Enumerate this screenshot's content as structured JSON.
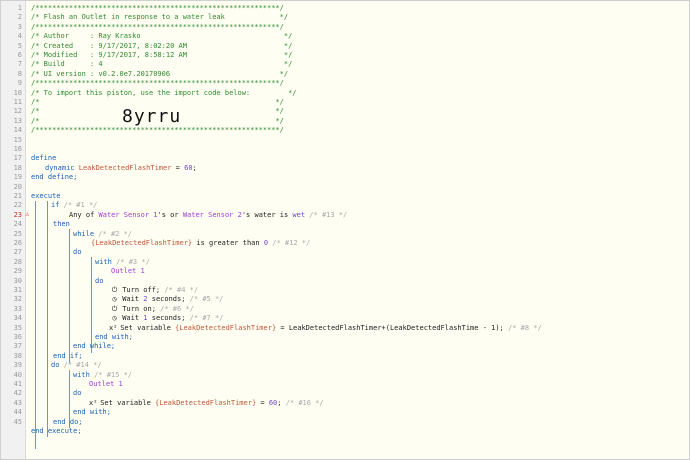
{
  "line_numbers": [
    "1",
    "2",
    "3",
    "4",
    "5",
    "6",
    "7",
    "8",
    "9",
    "10",
    "11",
    "12",
    "13",
    "14",
    "15",
    "16",
    "17",
    "18",
    "19",
    "20",
    "21",
    "22",
    "23",
    "24",
    "25",
    "26",
    "27",
    "28",
    "29",
    "30",
    "31",
    "32",
    "33",
    "34",
    "35",
    "36",
    "37",
    "38",
    "39",
    "40",
    "41",
    "42",
    "43",
    "44",
    "45"
  ],
  "header": {
    "border": "/**********************************************************/",
    "title": "/* Flash an Outlet in response to a water leak             */",
    "author": "/* Author     : Ray Krasko                                  */",
    "created": "/* Created    : 9/17/2017, 8:02:20 AM                       */",
    "modified": "/* Modified   : 9/17/2017, 8:58:12 AM                       */",
    "build": "/* Build      : 4                                           */",
    "ui_version": "/* UI version : v0.2.0e7.20170906                          */",
    "import_text": "/* To import this piston, use the import code below:         */",
    "blank_line": "/*                                                        */",
    "import_code": "8yrru"
  },
  "code": {
    "define": "define",
    "dynamic": "dynamic",
    "var_name": "LeakDetectedFlashTimer",
    "eq": " = ",
    "val60": "60",
    "semi": ";",
    "end_define": "end define;",
    "execute": "execute",
    "if": "if",
    "c1": "/* #1 */",
    "any_of": "Any of ",
    "ws1": "Water Sensor 1",
    "s_or": "'s or ",
    "ws2": "Water Sensor 2",
    "s_water": "'s water is ",
    "wet": "wet",
    "c13": "/* #13 */",
    "then": "then",
    "while": "while",
    "c2": "/* #2 */",
    "var_braced": "{LeakDetectedFlashTimer}",
    "greater": " is greater than ",
    "zero": "0",
    "c12": "/* #12 */",
    "do": "do",
    "with": "with",
    "c3": "/* #3 */",
    "outlet": "Outlet 1",
    "turn_off": "Turn off;",
    "c4": "/* #4 */",
    "wait": "Wait ",
    "two": "2",
    "seconds": " seconds;",
    "c5": "/* #5 */",
    "turn_on": "Turn on;",
    "c6": "/* #6 */",
    "one": "1",
    "c7": "/* #7 */",
    "set_var": "Set variable ",
    "expr": "LeakDetectedFlashTimer+(LeakDetectedFlashTime - 1);",
    "c8": "/* #8 */",
    "end_with": "end with;",
    "end_while": "end while;",
    "end_if": "end if;",
    "c14": "/* #14 */",
    "c15": "/* #15 */",
    "c16": "/* #16 */",
    "end_do": "end do;",
    "end_execute": "end execute;"
  },
  "icons": {
    "power": "power-icon",
    "clock": "clock-icon",
    "variable": "variable-icon",
    "warning": "warning-icon"
  }
}
